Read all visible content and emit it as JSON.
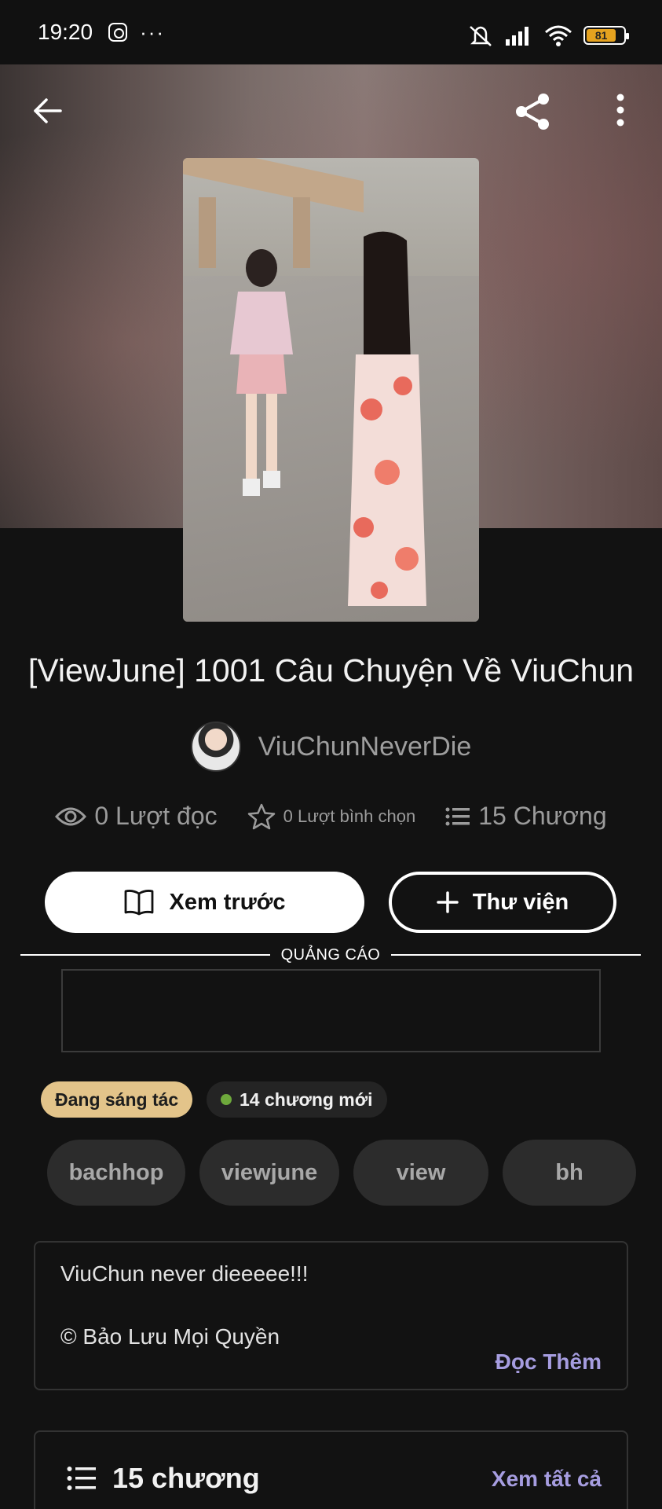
{
  "status_bar": {
    "time": "19:20",
    "dots": "···",
    "battery": "81"
  },
  "header": {
    "back": "back-arrow-icon",
    "share": "share-icon",
    "more": "more-vert-icon"
  },
  "story": {
    "title": "[ViewJune] 1001 Câu Chuyện Về ViuChun",
    "author": "ViuChunNeverDie",
    "reads": "0 Lượt đọc",
    "votes": "0 Lượt bình chọn",
    "chapters": "15 Chương"
  },
  "actions": {
    "preview": "Xem trước",
    "library": "Thư viện"
  },
  "ad": {
    "label": "QUẢNG CÁO"
  },
  "badges": {
    "status": "Đang sáng tác",
    "new_chapters": "14 chương mới"
  },
  "tags": [
    "bachhop",
    "viewjune",
    "view",
    "bh"
  ],
  "description": {
    "line1": "ViuChun never dieeeee!!!",
    "line2": "© Bảo Lưu Mọi Quyền",
    "read_more": "Đọc Thêm"
  },
  "chapter_list": {
    "title": "15 chương",
    "see_all": "Xem tất cả"
  }
}
